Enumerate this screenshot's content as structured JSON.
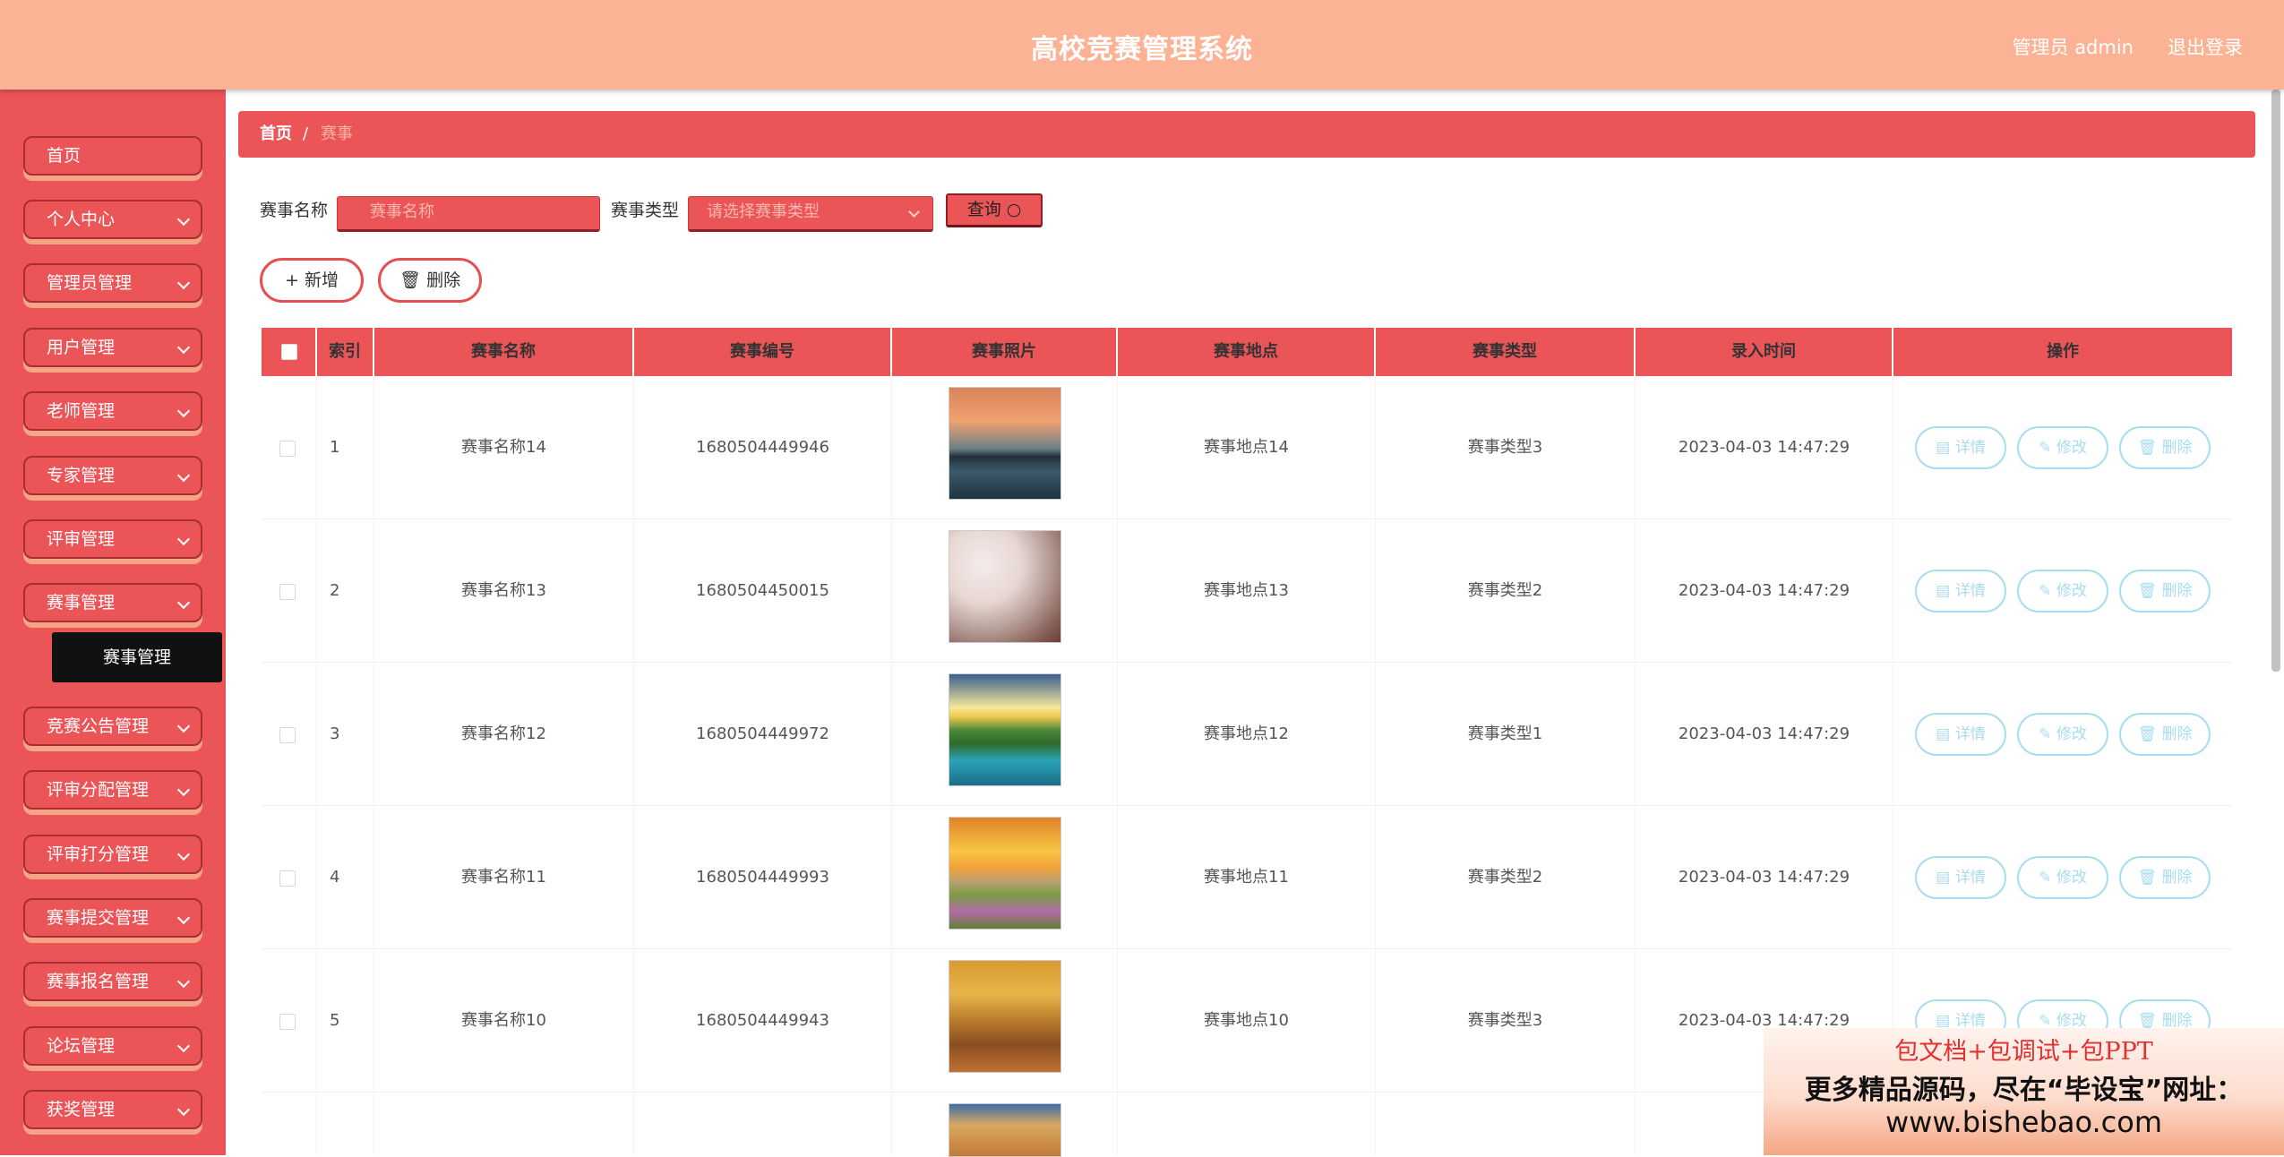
{
  "header": {
    "title": "高校竞赛管理系统",
    "user": "管理员 admin",
    "logout": "退出登录"
  },
  "sidebar": {
    "items": [
      {
        "label": "首页"
      },
      {
        "label": "个人中心"
      },
      {
        "label": "管理员管理"
      },
      {
        "label": "用户管理"
      },
      {
        "label": "老师管理"
      },
      {
        "label": "专家管理"
      },
      {
        "label": "评审管理"
      },
      {
        "label": "赛事管理"
      },
      {
        "label": "竞赛公告管理"
      },
      {
        "label": "评审分配管理"
      },
      {
        "label": "评审打分管理"
      },
      {
        "label": "赛事提交管理"
      },
      {
        "label": "赛事报名管理"
      },
      {
        "label": "论坛管理"
      },
      {
        "label": "获奖管理"
      }
    ],
    "active_sub": "赛事管理"
  },
  "breadcrumb": {
    "home": "首页",
    "sep": "/",
    "current": "赛事"
  },
  "search": {
    "name_label": "赛事名称",
    "name_placeholder": "赛事名称",
    "type_label": "赛事类型",
    "type_placeholder": "请选择赛事类型",
    "query_label": "查询 ○"
  },
  "actions": {
    "add": "+ 新增",
    "delete": "🗑 删除"
  },
  "table": {
    "headers": [
      "索引",
      "赛事名称",
      "赛事编号",
      "赛事照片",
      "赛事地点",
      "赛事类型",
      "录入时间",
      "操作"
    ],
    "row_actions": [
      "▤ 详情",
      "✎ 修改",
      "🗑 删除"
    ],
    "rows": [
      {
        "index": "1",
        "name": "赛事名称14",
        "code": "1680504449946",
        "location": "赛事地点14",
        "type": "赛事类型3",
        "time": "2023-04-03 14:47:29",
        "photo": "lake-moon"
      },
      {
        "index": "2",
        "name": "赛事名称13",
        "code": "1680504450015",
        "location": "赛事地点13",
        "type": "赛事类型2",
        "time": "2023-04-03 14:47:29",
        "photo": "blossom"
      },
      {
        "index": "3",
        "name": "赛事名称12",
        "code": "1680504449972",
        "location": "赛事地点12",
        "type": "赛事类型1",
        "time": "2023-04-03 14:47:29",
        "photo": "sunrise-lake"
      },
      {
        "index": "4",
        "name": "赛事名称11",
        "code": "1680504449993",
        "location": "赛事地点11",
        "type": "赛事类型2",
        "time": "2023-04-03 14:47:29",
        "photo": "sunset-meadow"
      },
      {
        "index": "5",
        "name": "赛事名称10",
        "code": "1680504449943",
        "location": "赛事地点10",
        "type": "赛事类型3",
        "time": "2023-04-03 14:47:29",
        "photo": "autumn-road"
      }
    ]
  },
  "promo": {
    "line1": "包文档+包调试+包PPT",
    "line2": "更多精品源码，尽在“毕设宝”网址：",
    "line3": "www.bishebao.com"
  },
  "colors": {
    "header": "#fcb395",
    "sidebar": "#ec5558",
    "accent": "#ec5558",
    "action_border": "#a9dcef"
  }
}
